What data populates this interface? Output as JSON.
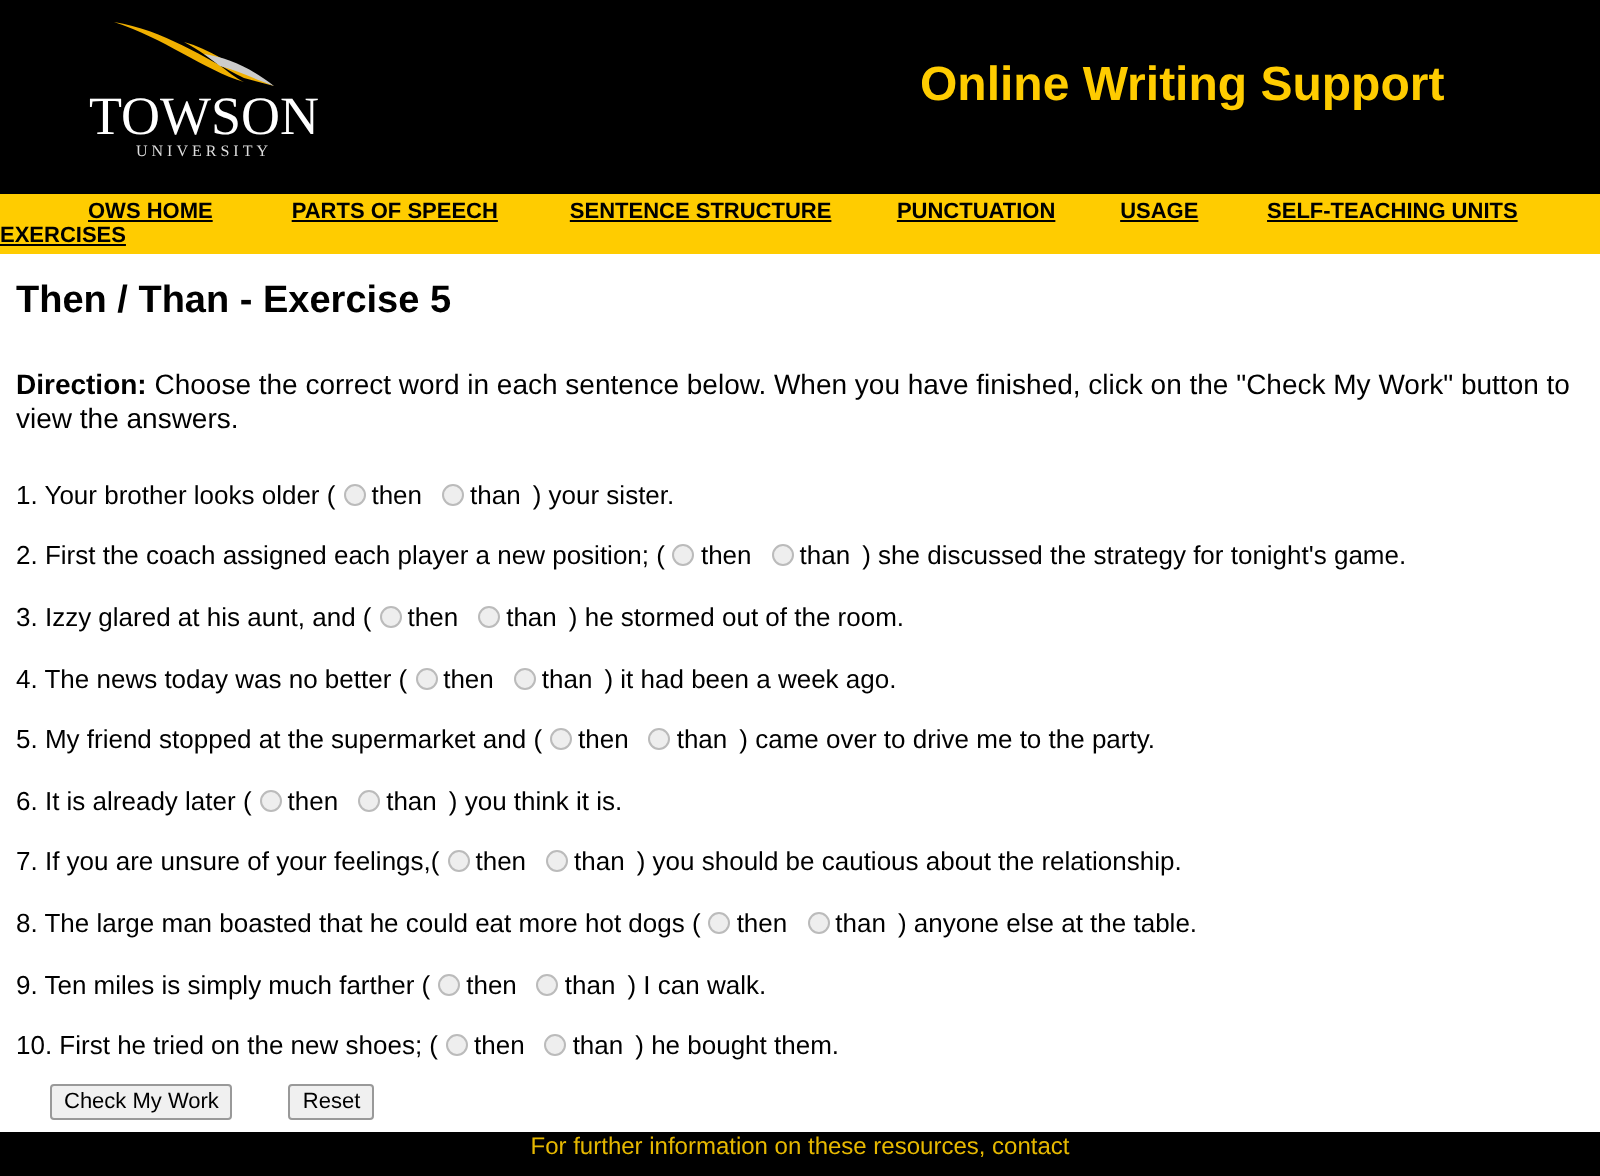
{
  "header": {
    "logo_name": "TOWSON",
    "logo_sub": "UNIVERSITY",
    "site_title": "Online Writing Support"
  },
  "nav": [
    "OWS HOME",
    "PARTS OF SPEECH",
    "SENTENCE STRUCTURE",
    "PUNCTUATION",
    "USAGE",
    "SELF-TEACHING UNITS",
    "EXERCISES"
  ],
  "title": "Then / Than - Exercise 5",
  "direction": {
    "label": "Direction:",
    "text": "Choose the correct word in each sentence below. When you have finished, click on the \"Check My Work\" button to view the answers."
  },
  "questions": [
    {
      "before": "1. Your brother looks older (",
      "options": [
        {
          "label": "then",
          "selected": false
        },
        {
          "label": "than",
          "selected": false
        }
      ],
      "after": ") your sister."
    },
    {
      "before": "2. First the coach assigned each player a new position; (",
      "options": [
        {
          "label": "then",
          "selected": false
        },
        {
          "label": "than",
          "selected": false
        }
      ],
      "after": ") she discussed the strategy for tonight's game."
    },
    {
      "before": "3. Izzy glared at his aunt, and (",
      "options": [
        {
          "label": "then",
          "selected": false
        },
        {
          "label": "than",
          "selected": false
        }
      ],
      "after": ") he stormed out of the room."
    },
    {
      "before": "4. The news today was no better (",
      "options": [
        {
          "label": "then",
          "selected": false
        },
        {
          "label": "than",
          "selected": false
        }
      ],
      "after": ") it had been a week ago."
    },
    {
      "before": "5. My friend stopped at the supermarket and (",
      "options": [
        {
          "label": "then",
          "selected": false
        },
        {
          "label": "than",
          "selected": false
        }
      ],
      "after": ") came over to drive me to the party."
    },
    {
      "before": "6. It is already later (",
      "options": [
        {
          "label": "then",
          "selected": false
        },
        {
          "label": "than",
          "selected": false
        }
      ],
      "after": ") you think it is."
    },
    {
      "before": "7. If you are unsure of your feelings,(",
      "options": [
        {
          "label": "then",
          "selected": false
        },
        {
          "label": "than",
          "selected": false
        }
      ],
      "after": ") you should be cautious about the relationship."
    },
    {
      "before": "8. The large man boasted that he could eat more hot dogs (",
      "options": [
        {
          "label": "then",
          "selected": false
        },
        {
          "label": "than",
          "selected": false
        }
      ],
      "after": ") anyone else at the table."
    },
    {
      "before": "9. Ten miles is simply much farther (",
      "options": [
        {
          "label": "then",
          "selected": false
        },
        {
          "label": "than",
          "selected": false
        }
      ],
      "after": ") I can walk."
    },
    {
      "before": "10. First he tried on the new shoes; (",
      "options": [
        {
          "label": "then",
          "selected": false
        },
        {
          "label": "than",
          "selected": false
        }
      ],
      "after": ") he bought them."
    }
  ],
  "buttons": [
    "Check My Work",
    "Reset"
  ],
  "footer": [
    "For further information on these resources, contact"
  ]
}
